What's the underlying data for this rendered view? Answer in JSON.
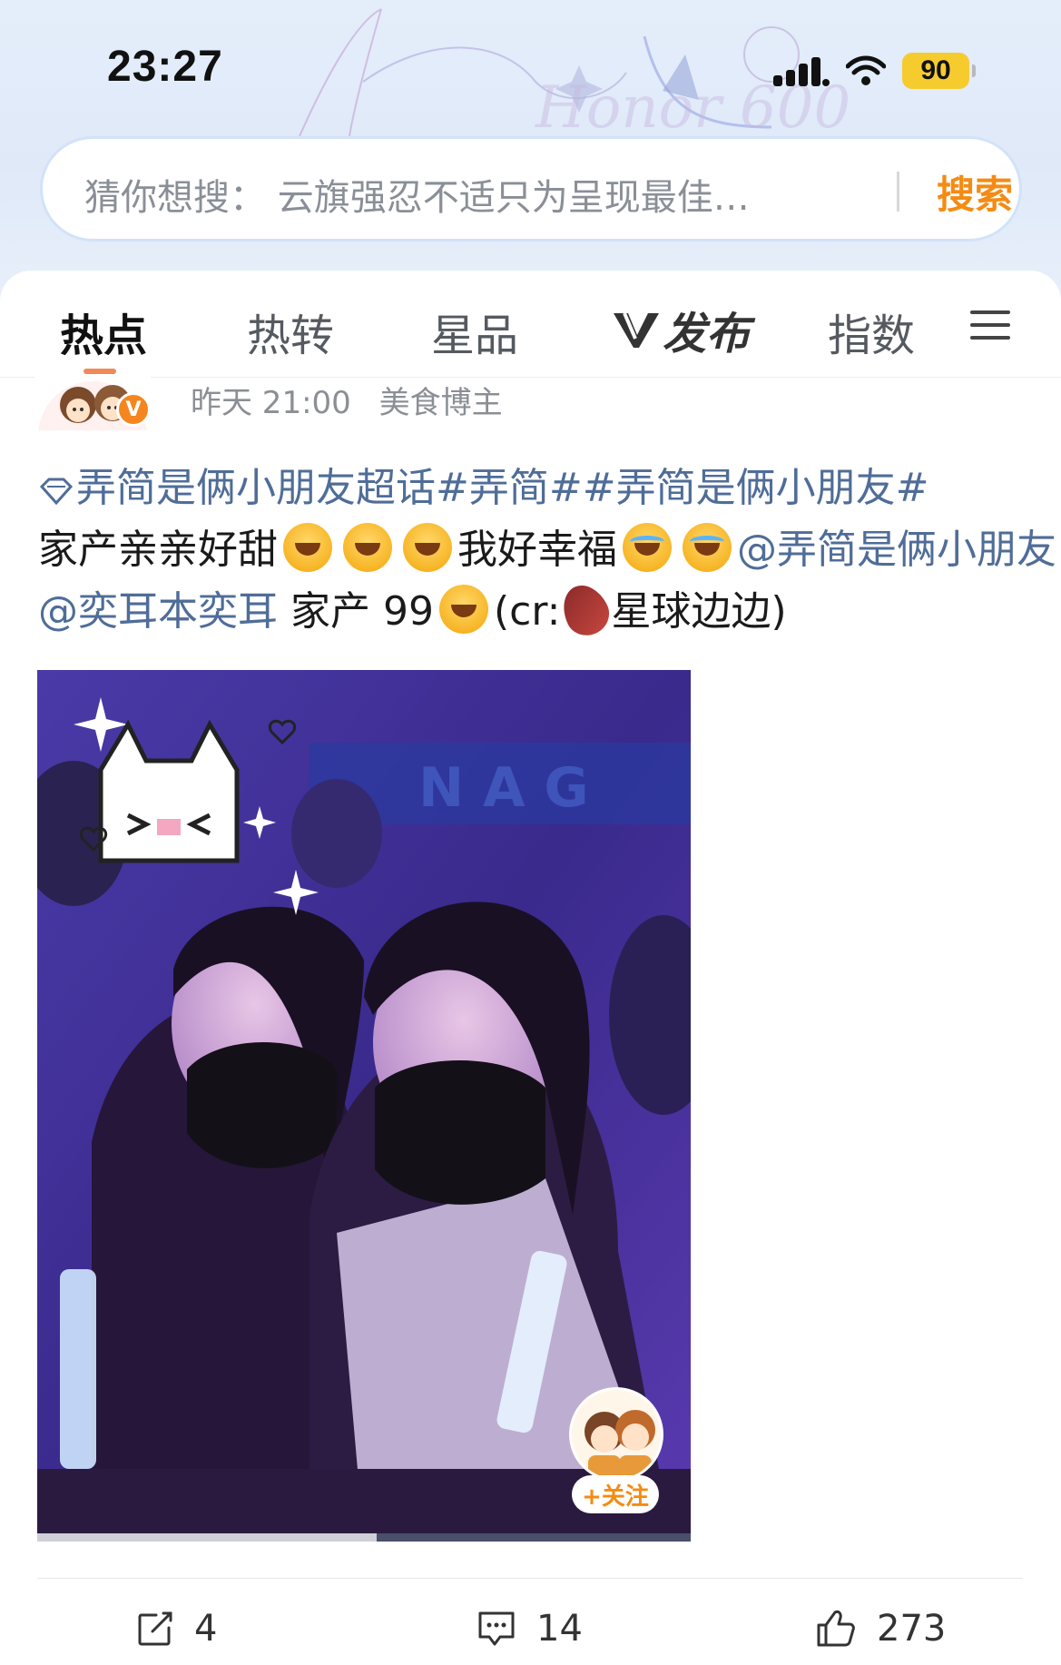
{
  "status_bar": {
    "time": "23:27",
    "battery": "90",
    "icons": [
      "signal-icon",
      "wifi-icon",
      "battery-icon"
    ]
  },
  "header": {
    "banner_text": "Honor 600",
    "search_placeholder": "猜你想搜：  云旗强忍不适只为呈现最佳…",
    "search_button": "搜索"
  },
  "tabs": [
    {
      "label": "热点",
      "active": true
    },
    {
      "label": "热转",
      "active": false
    },
    {
      "label": "星品",
      "active": false
    },
    {
      "label": "发布",
      "active": false,
      "logo": "V"
    },
    {
      "label": "指数",
      "active": false
    }
  ],
  "post": {
    "time": "昨天 21:00",
    "author_tag": "美食博主",
    "verified_badge": "V",
    "text": {
      "topic_link": "弄简是俩小朋友超话",
      "hashtag_1": "#弄简#",
      "hashtag_2": "#弄简是俩小朋友#",
      "line_2": "家产亲亲好甜",
      "line_2b": "我好幸福",
      "mention_1": "@弄简是俩小朋友",
      "mention_2": "@奕耳本奕耳",
      "tail_1": "家产 99",
      "tail_2": "(cr:",
      "tail_3": "星球边边)"
    },
    "media": {
      "progress": 0.52,
      "follow_label": "+关注"
    },
    "actions": {
      "share": "4",
      "comment": "14",
      "like": "273"
    }
  },
  "colors": {
    "accent": "#f48b13",
    "link": "#4f6d98",
    "battery": "#f6cb2e"
  }
}
